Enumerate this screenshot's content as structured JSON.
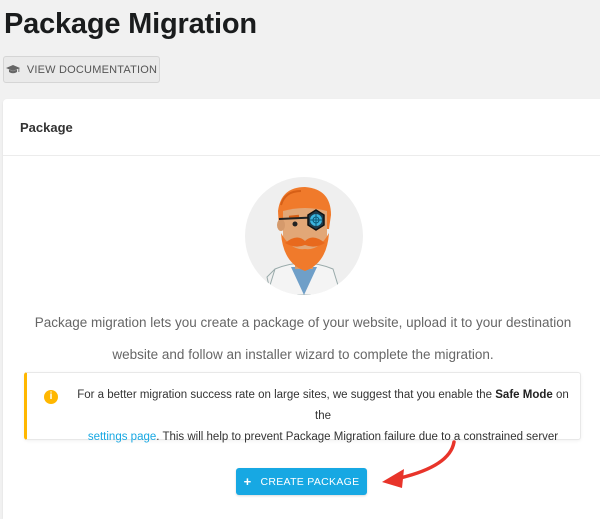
{
  "page": {
    "title": "Package Migration",
    "doc_button_label": "VIEW DOCUMENTATION"
  },
  "card": {
    "title": "Package",
    "description_line1": "Package migration lets you create a package of your website, upload it to your destination",
    "description_line2": "website and follow an installer wizard to complete the migration."
  },
  "notice": {
    "icon": "info-icon",
    "text_before_bold": "For a better migration success rate on large sites, we suggest that you enable the ",
    "bold_text": "Safe Mode",
    "text_after_bold": " on the",
    "link_text": "settings page",
    "text_after_link": ". This will help to prevent Package Migration failure due to a constrained server"
  },
  "create_button": {
    "icon": "+",
    "label": "CREATE PACKAGE"
  },
  "colors": {
    "accent": "#17a8e3",
    "warning": "#ffb700",
    "arrow": "#e8342a"
  }
}
